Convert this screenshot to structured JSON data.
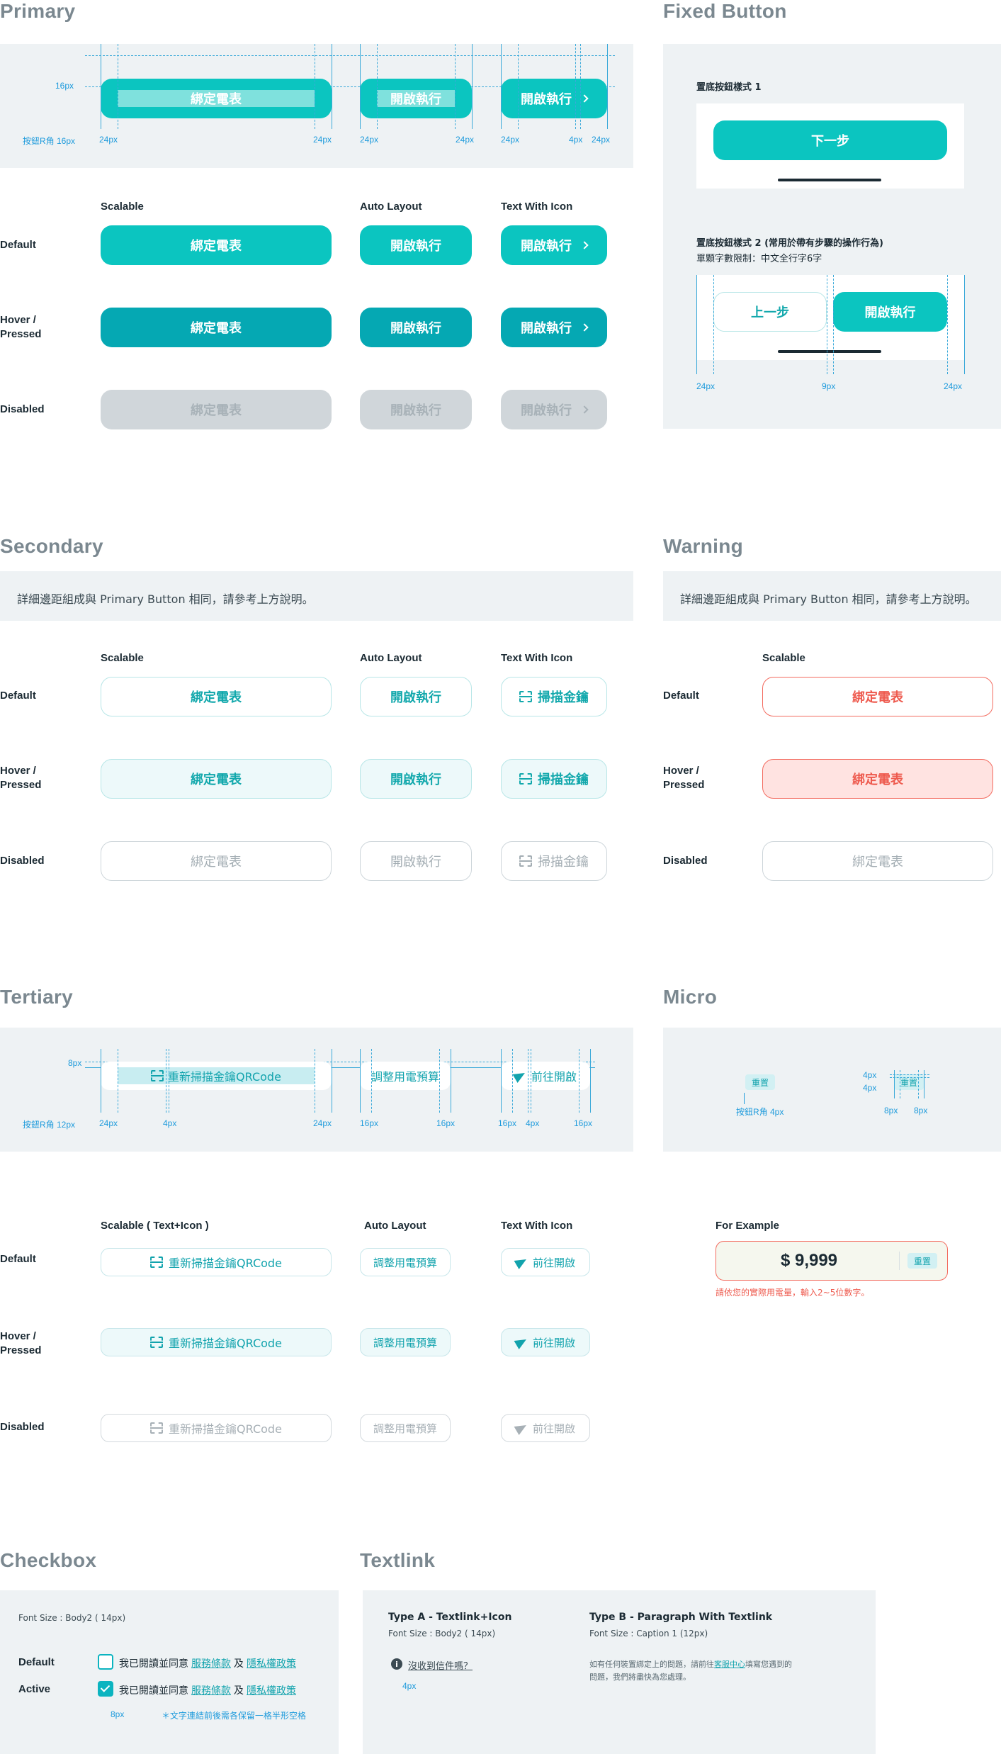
{
  "primary": {
    "title": "Primary",
    "spec": {
      "scalable_label": "綁定電表",
      "auto_label": "開啟執行",
      "icon_label": "開啟執行",
      "radius_note": "按鈕R角 16px",
      "top_pad": "16px",
      "m24": "24px",
      "m4": "4px"
    },
    "columns": [
      "Scalable",
      "Auto Layout",
      "Text With Icon"
    ],
    "rows": [
      "Default",
      "Hover /\nPressed",
      "Disabled"
    ],
    "labels": {
      "scalable": "綁定電表",
      "auto": "開啟執行",
      "icon": "開啟執行"
    }
  },
  "fixed": {
    "title": "Fixed Button",
    "style1_title": "置底按鈕樣式 1",
    "style1_button": "下一步",
    "style2_title": "置底按鈕樣式 2 (常用於帶有步驟的操作行為)",
    "style2_sub": "單顆字數限制：中文全行字6字",
    "prev": "上一步",
    "next": "開啟執行",
    "m24": "24px",
    "m9": "9px"
  },
  "secondary": {
    "title": "Secondary",
    "note": "詳細邊距組成與 Primary Button 相同，請參考上方說明。",
    "columns": [
      "Scalable",
      "Auto Layout",
      "Text With Icon"
    ],
    "rows": [
      "Default",
      "Hover /\nPressed",
      "Disabled"
    ],
    "labels": {
      "scalable": "綁定電表",
      "auto": "開啟執行",
      "icon": "掃描金鑰"
    }
  },
  "warning": {
    "title": "Warning",
    "note": "詳細邊距組成與 Primary Button 相同，請參考上方說明。",
    "column": "Scalable",
    "rows": [
      "Default",
      "Hover /\nPressed",
      "Disabled"
    ],
    "label": "綁定電表"
  },
  "tertiary": {
    "title": "Tertiary",
    "spec": {
      "radius_note": "按鈕R角 12px",
      "top_pad": "8px",
      "m24": "24px",
      "m4": "4px",
      "m16": "16px",
      "scalable": "重新掃描金鑰QRCode",
      "auto": "調整用電預算",
      "icon": "前往開啟"
    },
    "columns": [
      "Scalable ( Text+Icon )",
      "Auto Layout",
      "Text With Icon"
    ],
    "rows": [
      "Default",
      "Hover /\nPressed",
      "Disabled"
    ],
    "labels": {
      "scalable": "重新掃描金鑰QRCode",
      "auto": "調整用電預算",
      "icon": "前往開啟"
    }
  },
  "micro": {
    "title": "Micro",
    "label": "重置",
    "radius_note": "按鈕R角 4px",
    "m4": "4px",
    "m8": "8px",
    "example_title": "For Example",
    "amount": "$ 9,999",
    "reset": "重置",
    "error": "請依您的實際用電量，輸入2~5位數字。"
  },
  "checkbox": {
    "title": "Checkbox",
    "font_note": "Font Size : Body2 ( 14px)",
    "default": "Default",
    "active": "Active",
    "text_a": "我已閱讀並同意",
    "link1": "服務條款",
    "and": "及",
    "link2": "隱私權政策",
    "m8": "8px",
    "footnote": "＊文字連結前後需各保留一格半形空格"
  },
  "textlink": {
    "title": "Textlink",
    "type_a": "Type A - Textlink+Icon",
    "type_a_font": "Font Size : Body2 ( 14px)",
    "type_a_link": "沒收到信件嗎？",
    "m4": "4px",
    "type_b": "Type B - Paragraph With Textlink",
    "type_b_font": "Font Size : Caption 1 (12px)",
    "para_a": "如有任何裝置綁定上的問題，請前往",
    "para_link": "客服中心",
    "para_b": "填寫您遇到的",
    "para_c": "問題，我們將盡快為您處理。"
  }
}
